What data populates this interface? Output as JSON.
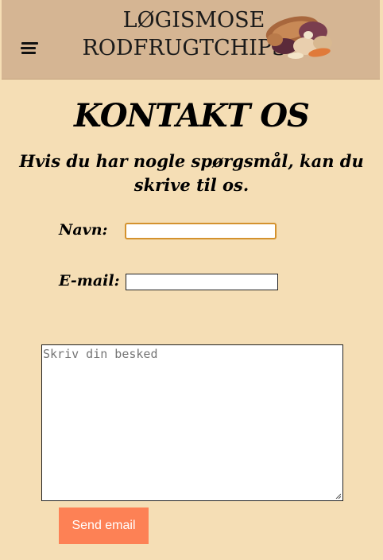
{
  "header": {
    "menu_icon": "hamburger-menu-icon",
    "logo_line1": "LØGISMOSE",
    "logo_line2": "RODFRUGTCHIPS",
    "logo_image": "root-vegetable-chips-icon"
  },
  "page": {
    "title": "KONTAKT OS",
    "subtitle": "Hvis du har nogle spørgsmål, kan du skrive til os."
  },
  "form": {
    "name_label": "Navn:",
    "name_value": "",
    "email_label": "E-mail:",
    "email_value": "",
    "message_placeholder": "Skriv din besked",
    "submit_label": "Send email"
  },
  "colors": {
    "background": "#f5deb5",
    "header": "#d5b593",
    "button": "#fd8155",
    "focus_border": "#d4922e"
  }
}
